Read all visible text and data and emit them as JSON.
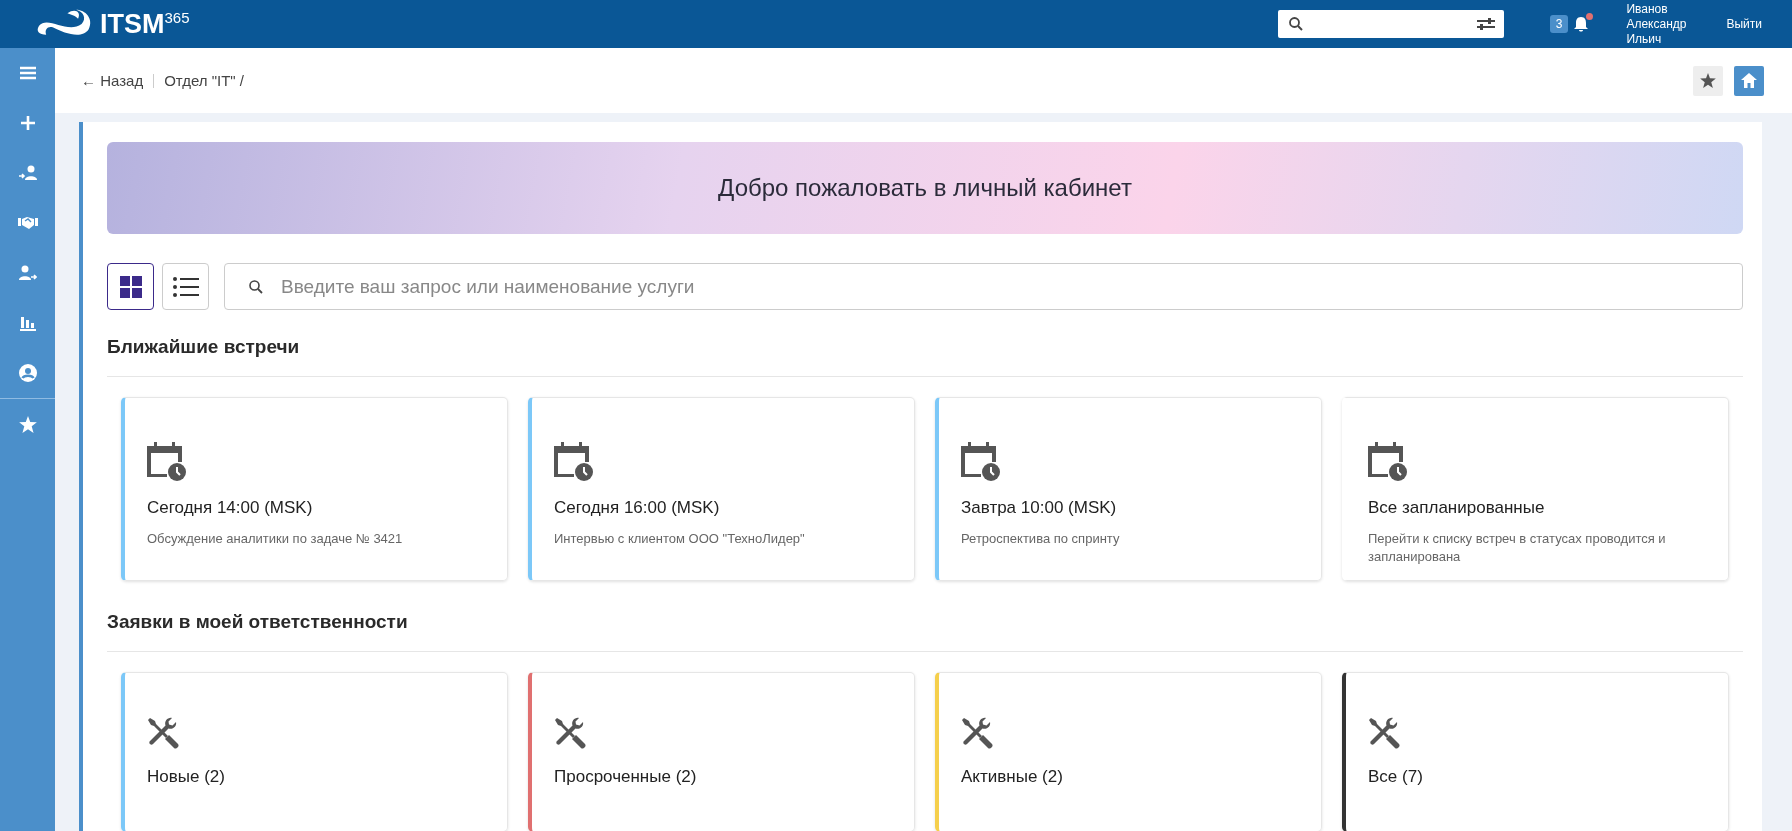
{
  "header": {
    "logo_text": "ITSM",
    "logo_sup": "365",
    "notification_count": "3",
    "notification_unread": true,
    "user_name": [
      "Иванов",
      "Александр",
      "Ильич"
    ],
    "logout": "Выйти"
  },
  "sidebar": {
    "items": [
      {
        "kind": "menu",
        "divider_before": false
      },
      {
        "kind": "plus",
        "divider_before": false
      },
      {
        "kind": "userin",
        "divider_before": false
      },
      {
        "kind": "handshake",
        "divider_before": false
      },
      {
        "kind": "userout",
        "divider_before": false
      },
      {
        "kind": "chart",
        "divider_before": false
      },
      {
        "kind": "account",
        "divider_before": false
      },
      {
        "kind": "star",
        "divider_before": true
      }
    ]
  },
  "breadcrumb": {
    "back": "← Назад",
    "path": "Отдел \"IT\" /"
  },
  "banner": {
    "title": "Добро пожаловать в личный кабинет"
  },
  "view_toggle": [
    {
      "kind": "grid",
      "selected": true
    },
    {
      "kind": "list",
      "selected": false
    }
  ],
  "search": {
    "placeholder": "Введите ваш запрос или наименование услуги"
  },
  "sections": [
    {
      "title": "Ближайшие встречи",
      "cards": [
        {
          "kind": "calendar",
          "title": "Сегодня 14:00 (MSK)",
          "subtitle": "Обсуждение аналитики по задаче № 3421",
          "color": "#7cc8f8"
        },
        {
          "kind": "calendar",
          "title": "Сегодня 16:00 (MSK)",
          "subtitle": "Интервью с клиентом ООО \"ТехноЛидер\"",
          "color": "#7cc8f8"
        },
        {
          "kind": "calendar",
          "title": "Завтра 10:00 (MSK)",
          "subtitle": "Ретроспектива по спринту",
          "color": "#7cc8f8"
        },
        {
          "kind": "calendar",
          "title": "Все запланированные",
          "subtitle": "Перейти к списку встреч в статусах проводится и запланирована"
        }
      ]
    },
    {
      "title": "Заявки в моей ответственности",
      "cards": [
        {
          "kind": "tools",
          "title": "Новые (2)",
          "color": "#7cc8f8"
        },
        {
          "kind": "tools",
          "title": "Просроченные (2)",
          "color": "#e07070"
        },
        {
          "kind": "tools",
          "title": "Активные (2)",
          "color": "#f5cf4c"
        },
        {
          "kind": "tools",
          "title": "Все (7)",
          "color": "#333333"
        }
      ]
    }
  ]
}
